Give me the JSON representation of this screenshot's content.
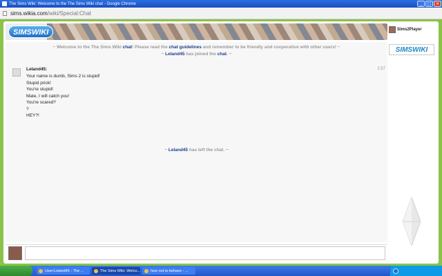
{
  "window": {
    "title": "The Sims Wiki: Welcome to the The Sims Wiki chat - Google Chrome",
    "controls": [
      "_",
      "□",
      "×"
    ]
  },
  "browser": {
    "url_host": "sims.wikia.com",
    "url_path": "/wiki/Special:Chat"
  },
  "header": {
    "logo_text": "SIMSWIKI"
  },
  "sidebar": {
    "user_name": "Sims2Player",
    "logo_text": "SIMSWIKI"
  },
  "chat": {
    "welcome": {
      "part1": "~ Welcome to the The Sims Wiki ",
      "link1": "chat",
      "part2": "! Please read the ",
      "link2": "chat guidelines",
      "part3": " and remember to be friendly and cooperative with other users! ~"
    },
    "joined": {
      "prefix": "~ ",
      "user": "Leland45",
      "middle": " has joined the ",
      "link": "chat",
      "suffix": ". ~"
    },
    "message": {
      "author": "Leland45:",
      "time": "2:57",
      "lines": [
        "Your name is dumb, Sims 2 is stupid!",
        "Stupid prick!",
        "You're stupid!",
        "Mate, I will catch you!",
        "You're scared?",
        "?",
        "HEY?!"
      ]
    },
    "left": {
      "prefix": "~ ",
      "user": "Leland45",
      "suffix": " has left the chat. ~"
    }
  },
  "taskbar": {
    "tasks": [
      "User:Leland45 - The ...",
      "The Sims Wiki: Welco...",
      "how not to behave - ..."
    ]
  },
  "colors": {
    "page_bg": "#8bc34a",
    "link": "#1a3d8a",
    "notice": "#9a9a9a"
  }
}
